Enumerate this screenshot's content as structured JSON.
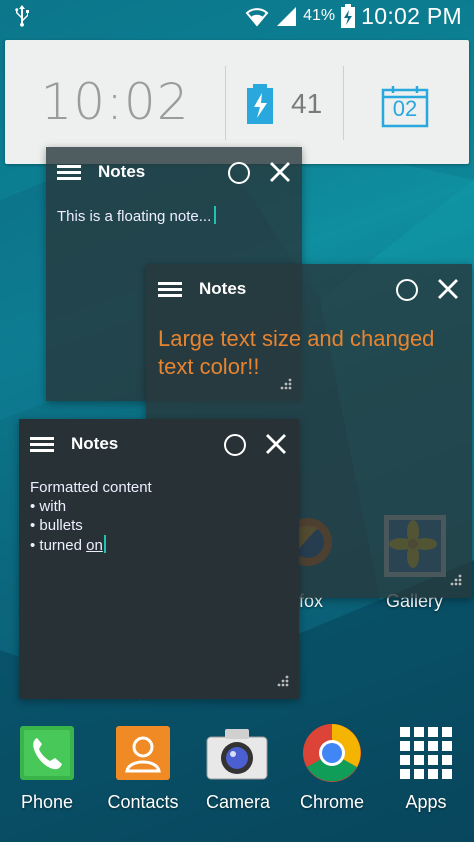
{
  "status_bar": {
    "wifi_icon": "wifi-icon",
    "signal_icon": "signal-icon",
    "battery_percent": "41%",
    "time": "10:02 PM"
  },
  "widget": {
    "clock": "10:02",
    "battery_value": "41",
    "calendar_day": "02"
  },
  "notes": [
    {
      "title": "Notes",
      "body": "This is a floating note..."
    },
    {
      "title": "Notes",
      "body": "Large text size and changed text color!!",
      "body_color": "#e8842f"
    },
    {
      "title": "Notes",
      "lines": [
        "Formatted content",
        "• with",
        "• bullets",
        "• turned "
      ],
      "underlined": "on"
    }
  ],
  "home_icons": {
    "firefox_partial_label": "fox",
    "gallery_label": "Gallery"
  },
  "dock": [
    {
      "label": "Phone",
      "icon": "phone-icon"
    },
    {
      "label": "Contacts",
      "icon": "contacts-icon"
    },
    {
      "label": "Camera",
      "icon": "camera-icon"
    },
    {
      "label": "Chrome",
      "icon": "chrome-icon"
    },
    {
      "label": "Apps",
      "icon": "apps-grid-icon"
    }
  ],
  "colors": {
    "accent_teal": "#1ec4b0",
    "note_orange": "#e8842f",
    "calendar_blue": "#29a8de"
  }
}
